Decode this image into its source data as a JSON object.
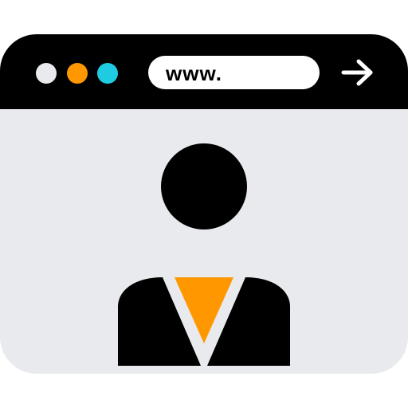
{
  "titlebar": {
    "dots": [
      {
        "name": "window-dot-gray",
        "color": "#e8eaee"
      },
      {
        "name": "window-dot-orange",
        "color": "#ff9800"
      },
      {
        "name": "window-dot-cyan",
        "color": "#1fcbe0"
      }
    ]
  },
  "address_bar": {
    "value": "www."
  },
  "go_button": {
    "icon": "arrow-right-icon"
  },
  "content": {
    "avatar_icon": "user-profile-icon",
    "tie_color": "#ff9800"
  },
  "colors": {
    "frame": "#000000",
    "content_background": "#e8eaee",
    "address_background": "#ffffff"
  }
}
